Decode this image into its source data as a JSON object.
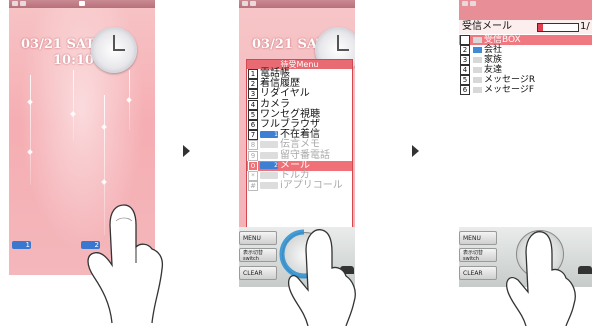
{
  "screen1": {
    "date": "03/21 SAT",
    "time": "10:10",
    "badge1": "1",
    "badge2": "2"
  },
  "screen2": {
    "date": "03/21 SAT",
    "menu_title": "待受Menu",
    "items": [
      {
        "num": "1",
        "label": "電話帳",
        "state": "normal"
      },
      {
        "num": "2",
        "label": "着信履歴",
        "state": "normal"
      },
      {
        "num": "3",
        "label": "リダイヤル",
        "state": "normal"
      },
      {
        "num": "4",
        "label": "カメラ",
        "state": "normal"
      },
      {
        "num": "5",
        "label": "ワンセグ視聴",
        "state": "normal"
      },
      {
        "num": "6",
        "label": "フルブラウザ",
        "state": "normal"
      },
      {
        "num": "7",
        "label": "不在着信",
        "state": "normal",
        "icon_count": "1"
      },
      {
        "num": "8",
        "label": "伝言メモ",
        "state": "dim"
      },
      {
        "num": "9",
        "label": "留守番電話",
        "state": "dim"
      },
      {
        "num": "0",
        "label": "メール",
        "state": "selected",
        "icon_count": "2"
      },
      {
        "num": "*",
        "label": "トルカ",
        "state": "dim"
      },
      {
        "num": "#",
        "label": "iアプリコール",
        "state": "dim"
      }
    ],
    "softkeys": {
      "menu": "MENU",
      "switch_top": "表示切替",
      "switch_bottom": "switch",
      "clear": "CLEAR"
    }
  },
  "screen3": {
    "title": "受信メール",
    "page": "1/",
    "rows": [
      {
        "num": "1",
        "label": "受信BOX",
        "state": "selected"
      },
      {
        "num": "2",
        "label": "会社",
        "state": "normal",
        "folder_color": "blue"
      },
      {
        "num": "3",
        "label": "家族",
        "state": "normal"
      },
      {
        "num": "4",
        "label": "友達",
        "state": "normal"
      },
      {
        "num": "5",
        "label": "メッセージR",
        "state": "normal"
      },
      {
        "num": "6",
        "label": "メッセージF",
        "state": "normal"
      }
    ],
    "softkeys": {
      "menu": "MENU",
      "switch_top": "表示切替",
      "switch_bottom": "switch",
      "clear": "CLEAR"
    }
  },
  "colors": {
    "accent_pink": "#f07078",
    "menu_border": "#d4474f",
    "folder_blue": "#3f8bd8"
  },
  "icons": [
    "step-arrow-icon",
    "finger-tap-icon",
    "clock-icon",
    "mail-badge-icon",
    "folder-icon"
  ]
}
